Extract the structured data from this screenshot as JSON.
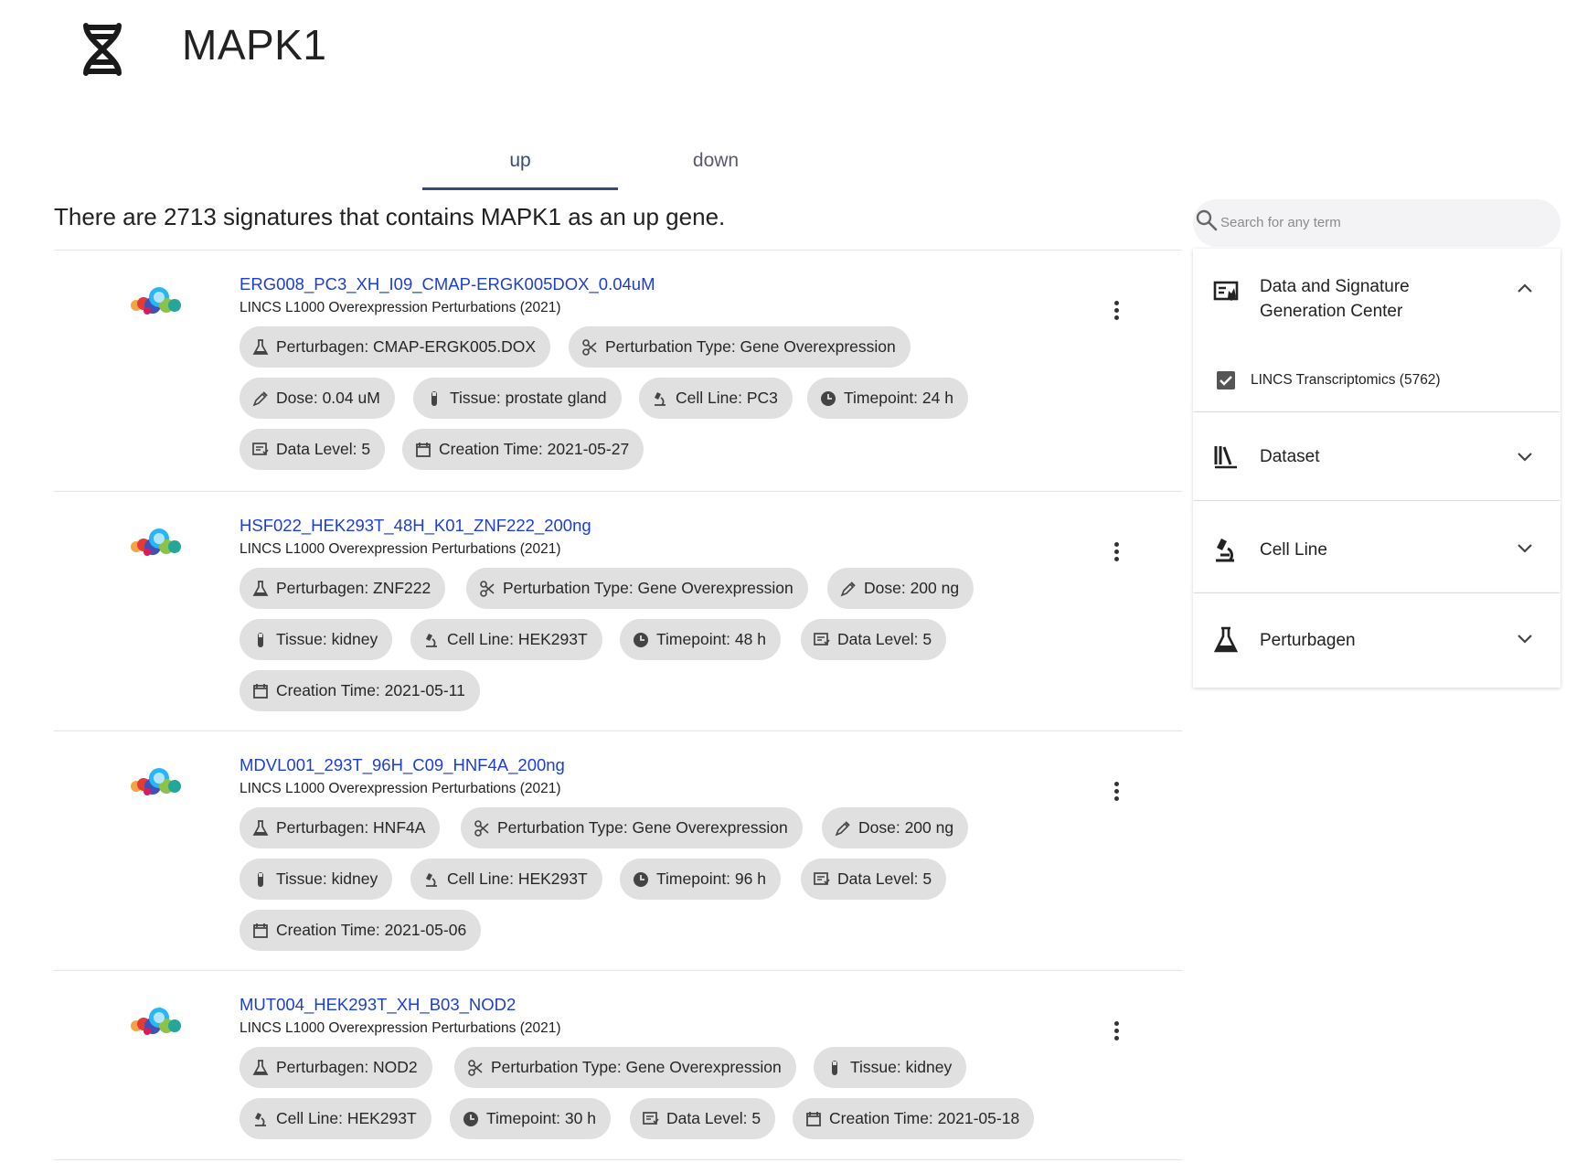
{
  "header": {
    "title": "MAPK1",
    "icon": "dna-icon"
  },
  "tabs": [
    {
      "label": "up",
      "active": true
    },
    {
      "label": "down",
      "active": false
    }
  ],
  "summary": "There are 2713 signatures that contains MAPK1 as an up gene.",
  "search": {
    "placeholder": "Search for any term"
  },
  "signatures": [
    {
      "name": "ERG008_PC3_XH_I09_CMAP-ERGK005DOX_0.04uM",
      "library": "LINCS L1000 Overexpression Perturbations (2021)",
      "chips": [
        "Perturbagen: CMAP-ERGK005.DOX",
        "Perturbation Type: Gene Overexpression",
        "Dose: 0.04 uM",
        "Tissue: prostate gland",
        "Cell Line: PC3",
        "Timepoint: 24 h",
        "Data Level: 5",
        "Creation Time: 2021-05-27"
      ]
    },
    {
      "name": "HSF022_HEK293T_48H_K01_ZNF222_200ng",
      "library": "LINCS L1000 Overexpression Perturbations (2021)",
      "chips": [
        "Perturbagen: ZNF222",
        "Perturbation Type: Gene Overexpression",
        "Dose: 200 ng",
        "Tissue: kidney",
        "Cell Line: HEK293T",
        "Timepoint: 48 h",
        "Data Level: 5",
        "Creation Time: 2021-05-11"
      ]
    },
    {
      "name": "MDVL001_293T_96H_C09_HNF4A_200ng",
      "library": "LINCS L1000 Overexpression Perturbations (2021)",
      "chips": [
        "Perturbagen: HNF4A",
        "Perturbation Type: Gene Overexpression",
        "Dose: 200 ng",
        "Tissue: kidney",
        "Cell Line: HEK293T",
        "Timepoint: 96 h",
        "Data Level: 5",
        "Creation Time: 2021-05-06"
      ]
    },
    {
      "name": "MUT004_HEK293T_XH_B03_NOD2",
      "library": "LINCS L1000 Overexpression Perturbations (2021)",
      "chips": [
        "Perturbagen: NOD2",
        "Perturbation Type: Gene Overexpression",
        "Tissue: kidney",
        "Cell Line: HEK293T",
        "Timepoint: 30 h",
        "Data Level: 5",
        "Creation Time: 2021-05-18"
      ]
    }
  ],
  "filters": [
    {
      "label": "Data and Signature Generation Center",
      "icon": "dcc-icon",
      "expanded": true,
      "options": [
        {
          "label": "LINCS Transcriptomics (5762)",
          "checked": true
        }
      ]
    },
    {
      "label": "Dataset",
      "icon": "library-icon",
      "expanded": false
    },
    {
      "label": "Cell Line",
      "icon": "microscope-icon",
      "expanded": false
    },
    {
      "label": "Perturbagen",
      "icon": "flask-icon",
      "expanded": false
    }
  ]
}
